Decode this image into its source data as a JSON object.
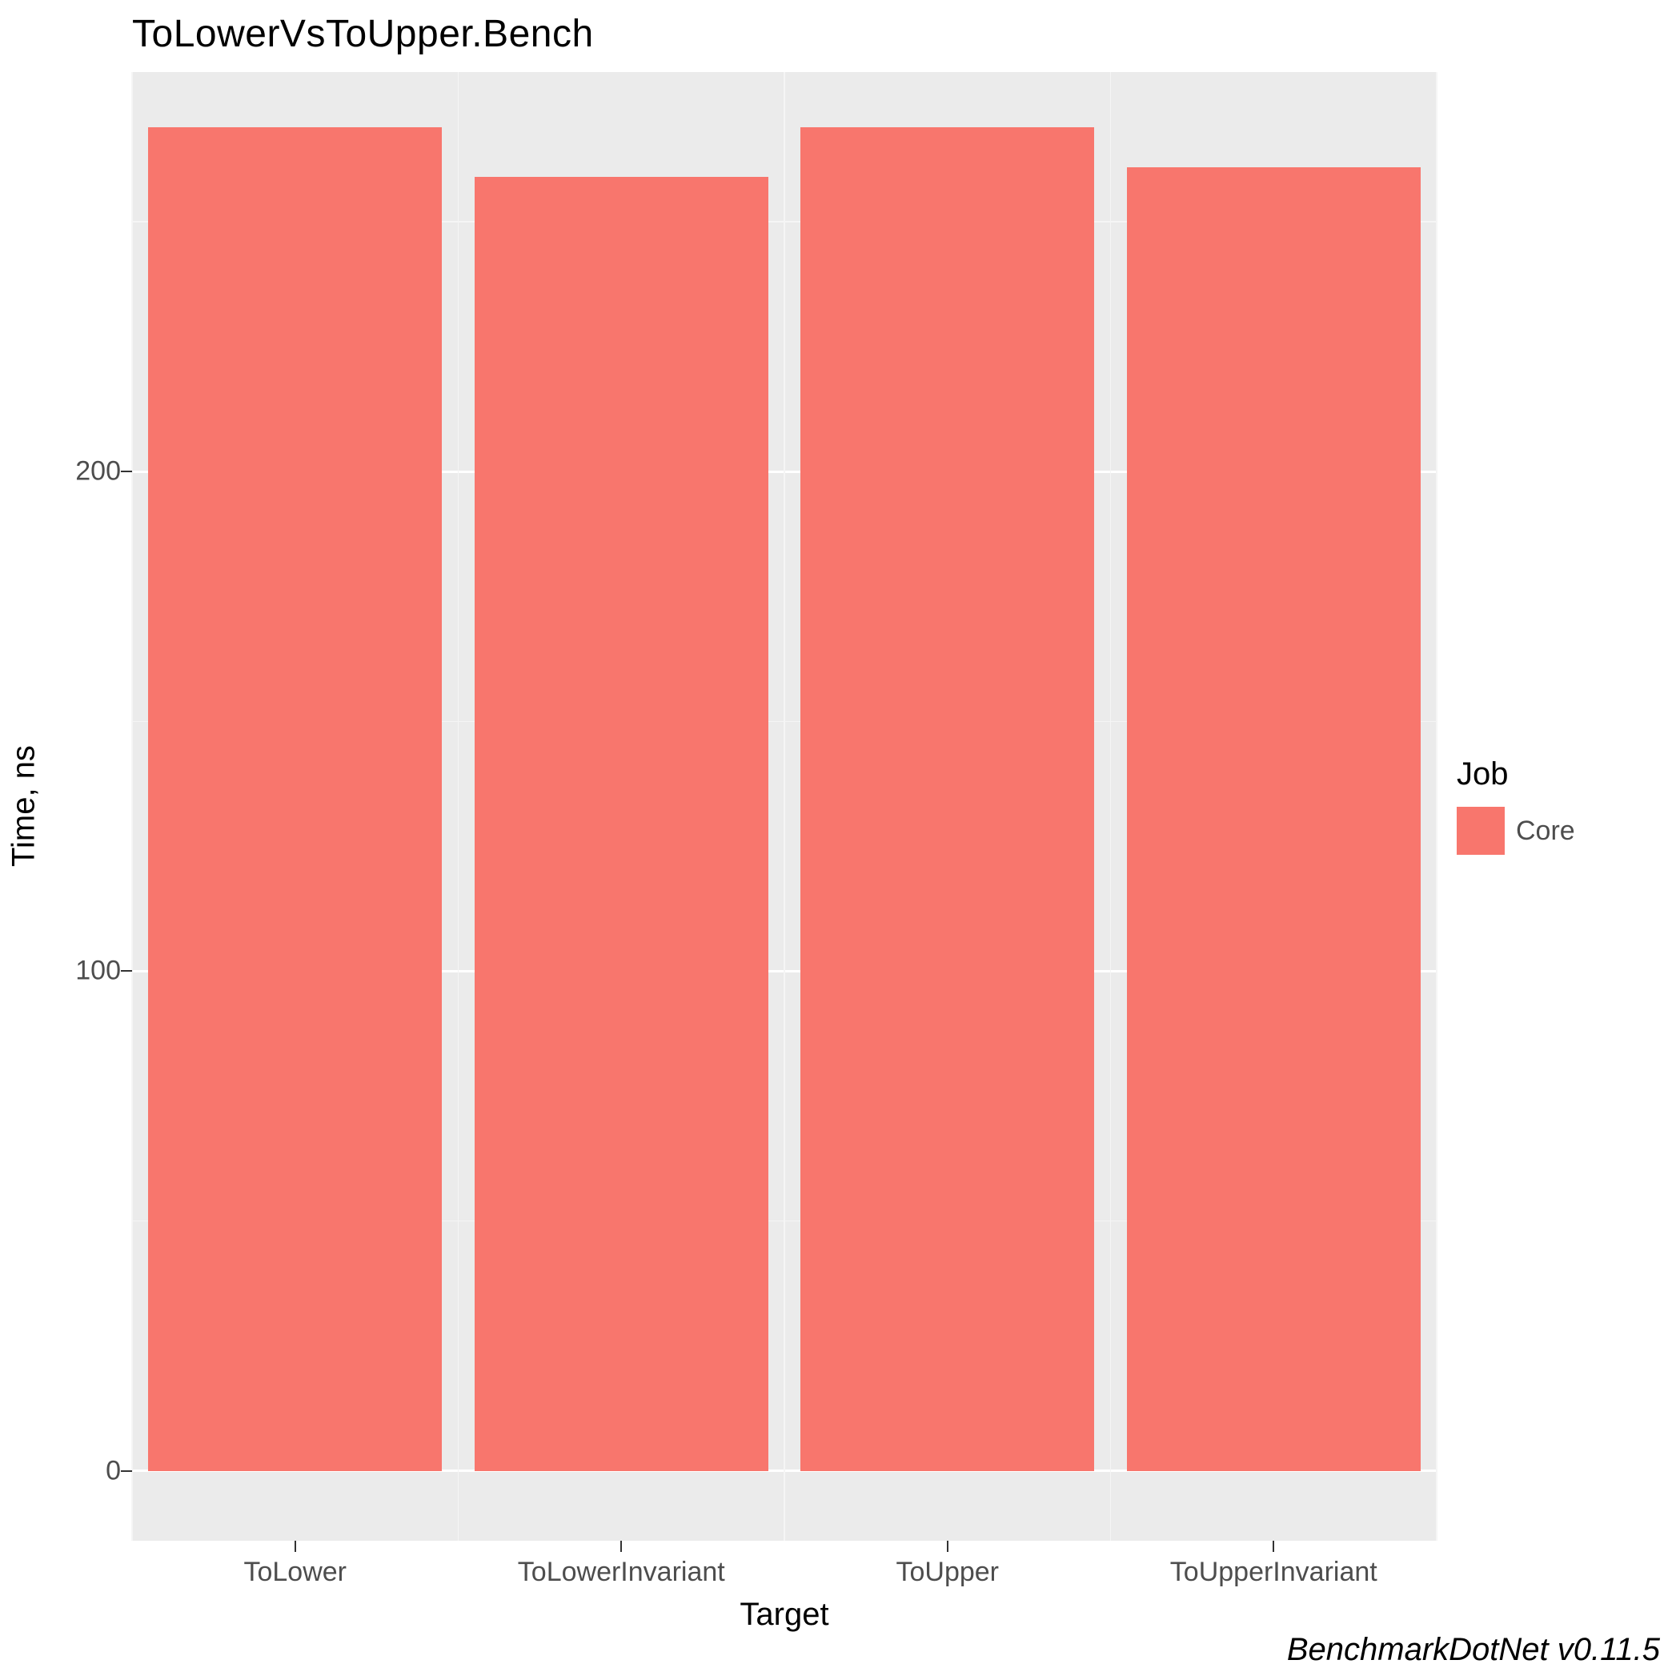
{
  "chart_data": {
    "type": "bar",
    "title": "ToLowerVsToUpper.Bench",
    "xlabel": "Target",
    "ylabel": "Time, ns",
    "y_ticks": [
      0,
      100,
      200
    ],
    "ylim": [
      -14,
      280
    ],
    "categories": [
      "ToLower",
      "ToLowerInvariant",
      "ToUpper",
      "ToUpperInvariant"
    ],
    "series": [
      {
        "name": "Core",
        "values": [
          269,
          259,
          269,
          261
        ],
        "color": "#f8766d"
      }
    ],
    "legend_title": "Job",
    "credit": "BenchmarkDotNet v0.11.5"
  }
}
